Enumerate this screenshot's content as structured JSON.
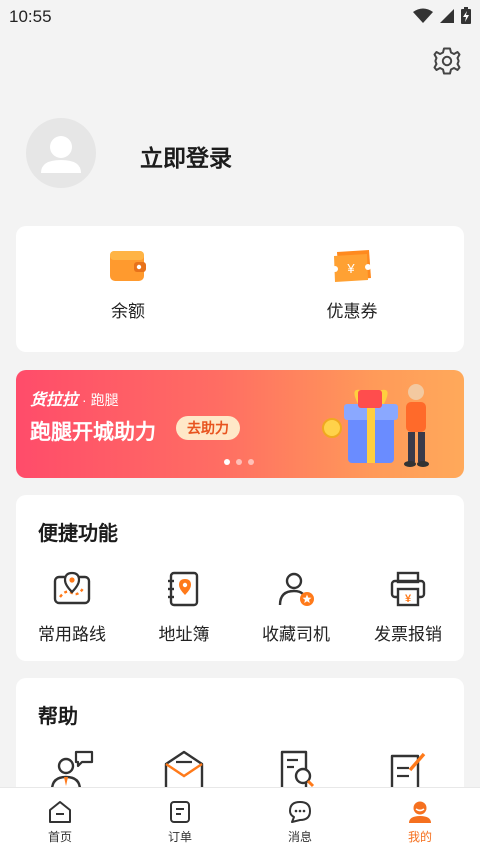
{
  "status_bar": {
    "time": "10:55"
  },
  "profile": {
    "login_label": "立即登录"
  },
  "wallet": {
    "balance_label": "余额",
    "coupon_label": "优惠券",
    "coupon_symbol": "¥"
  },
  "banner": {
    "brand": "货拉拉",
    "brand_sub": "· 跑腿",
    "title": "跑腿开城助力",
    "cta": "去助力",
    "page_count": 3,
    "active_page": 1
  },
  "quick_functions": {
    "title": "便捷功能",
    "items": [
      {
        "label": "常用路线",
        "icon": "route-map-icon"
      },
      {
        "label": "地址簿",
        "icon": "address-book-icon"
      },
      {
        "label": "收藏司机",
        "icon": "favorite-driver-icon"
      },
      {
        "label": "发票报销",
        "icon": "invoice-icon"
      }
    ]
  },
  "help": {
    "title": "帮助",
    "items": [
      {
        "icon": "customer-service-icon"
      },
      {
        "icon": "message-mail-icon"
      },
      {
        "icon": "search-doc-icon"
      },
      {
        "icon": "feedback-edit-icon"
      }
    ]
  },
  "tabs": [
    {
      "label": "首页",
      "icon": "home-icon"
    },
    {
      "label": "订单",
      "icon": "order-icon"
    },
    {
      "label": "消息",
      "icon": "message-icon"
    },
    {
      "label": "我的",
      "icon": "profile-icon"
    }
  ],
  "colors": {
    "accent": "#f5701f",
    "banner_start": "#ff4c6a",
    "banner_end": "#ffa95a"
  }
}
